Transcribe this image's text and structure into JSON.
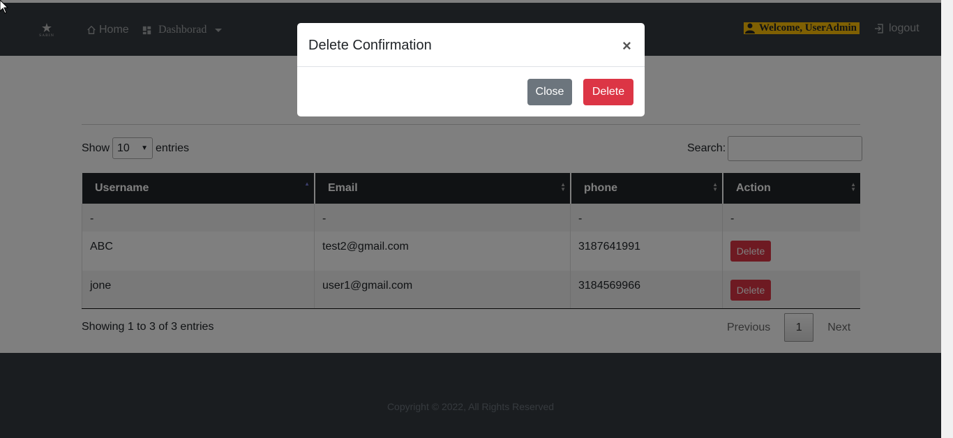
{
  "navbar": {
    "logo_text": "SABIN",
    "home_label": "Home",
    "dashboard_label": "Dashborad",
    "welcome_label": "Welcome, UserAdmin",
    "logout_label": "logout"
  },
  "controls": {
    "show_label": "Show",
    "entries_label": "entries",
    "page_length": "10",
    "search_label": "Search:"
  },
  "table": {
    "columns": [
      "Username",
      "Email",
      "phone",
      "Action"
    ],
    "rows": [
      {
        "username": "-",
        "email": "-",
        "phone": "-",
        "action": "-"
      },
      {
        "username": "ABC",
        "email": "test2@gmail.com",
        "phone": "3187641991",
        "action": "Delete"
      },
      {
        "username": "jone",
        "email": "user1@gmail.com",
        "phone": "3184569966",
        "action": "Delete"
      }
    ]
  },
  "footer_table": {
    "info": "Showing 1 to 3 of 3 entries",
    "previous": "Previous",
    "page": "1",
    "next": "Next"
  },
  "footer": {
    "copyright": "Copyright © 2022, All Rights Reserved"
  },
  "modal": {
    "title": "Delete Confirmation",
    "close_symbol": "×",
    "close_label": "Close",
    "delete_label": "Delete"
  },
  "colors": {
    "navbar": "#343a40",
    "danger": "#dc3545",
    "secondary": "#6c757d",
    "warning": "#ffc107"
  }
}
